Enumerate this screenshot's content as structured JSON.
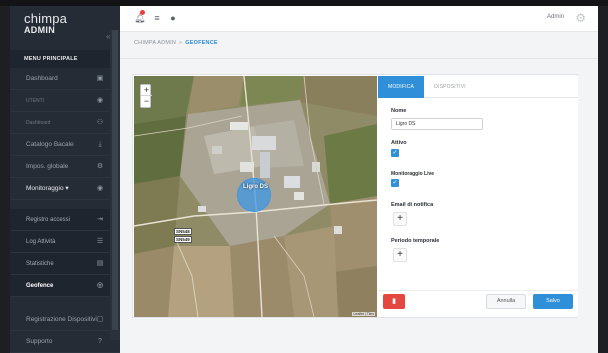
{
  "brand": {
    "line1": "chimpa",
    "line2": "ADMIN"
  },
  "sidebar": {
    "toggle_icon": "double-chevron-left-icon",
    "header": "MENU PRINCIPALE",
    "items": [
      {
        "label": "Dashboard",
        "icon": "dashboard-icon"
      },
      {
        "label": "UTENTI",
        "icon": "eye-icon"
      },
      {
        "label": "Dashboard",
        "icon": "users-icon"
      },
      {
        "label": "Catalogo Bacale",
        "icon": "download-icon"
      },
      {
        "label": "Impos. globale",
        "icon": "settings-icon"
      },
      {
        "label": "Monitoraggio ▾",
        "icon": "eye-icon"
      },
      {
        "label": "Registro accessi",
        "icon": "login-icon"
      },
      {
        "label": "Log Attività",
        "icon": "list-icon"
      },
      {
        "label": "Statistiche",
        "icon": "chart-icon"
      },
      {
        "label": "Geofence",
        "icon": "target-icon"
      },
      {
        "label": "Registrazione Dispositivi",
        "icon": "device-icon"
      },
      {
        "label": "Supporto",
        "icon": "help-icon"
      }
    ]
  },
  "topbar": {
    "icons": [
      "notification-bell-icon",
      "list-icon",
      "globe-icon"
    ],
    "user": "Admin",
    "settings_icon": "gear-icon"
  },
  "breadcrumb": {
    "root": "CHIMPA ADMIN",
    "separator": "»",
    "current": "GEOFENCE"
  },
  "map": {
    "zoom_in": "+",
    "zoom_out": "−",
    "geofence_label": "Ligro DS",
    "road_labels": [
      "SN548",
      "SN549"
    ],
    "attribution": "Leaflet | Tiles"
  },
  "form": {
    "tabs": [
      {
        "label": "MODIFICA",
        "active": true
      },
      {
        "label": "DISPOSITIVI",
        "active": false
      }
    ],
    "name_label": "Nome",
    "name_value": "Ligro DS",
    "active_label": "Attivo",
    "active_checked": true,
    "live_label": "Monitoraggio Live",
    "live_checked": true,
    "email_label": "Email di notifica",
    "period_label": "Periodo temporale",
    "add_symbol": "+",
    "delete_icon": "trash-icon",
    "cancel_label": "Annulla",
    "save_label": "Salvo"
  },
  "colors": {
    "accent": "#2f8fd8",
    "danger": "#e4473f",
    "sidebar": "#252c36"
  }
}
